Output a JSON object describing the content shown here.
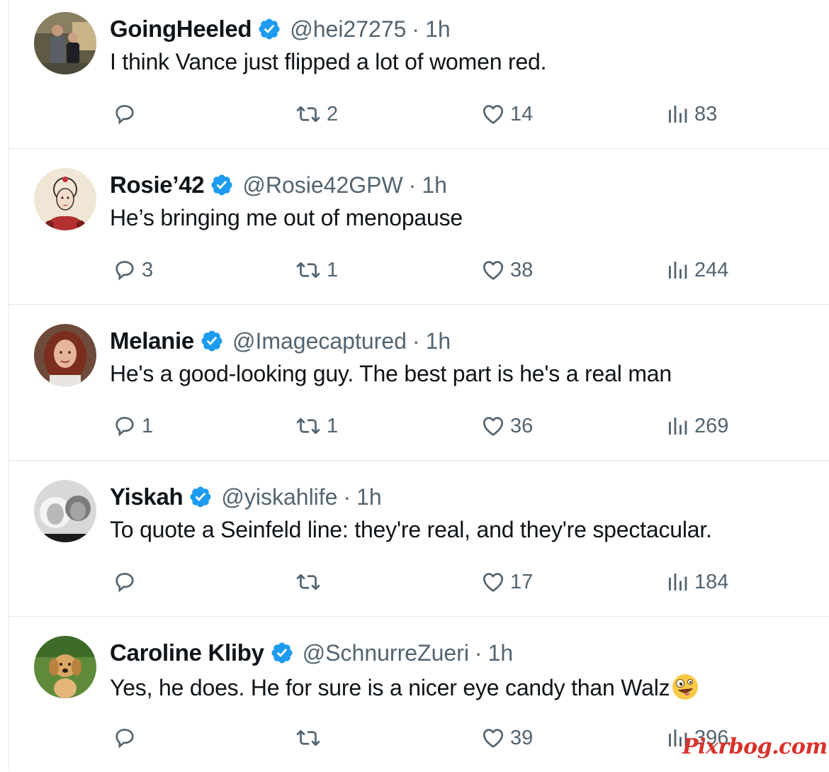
{
  "colors": {
    "text_primary": "#0f1419",
    "text_secondary": "#536471",
    "verified_blue": "#1d9bf0",
    "divider": "#e3e6e9",
    "watermark_red": "#d9312b"
  },
  "icons": {
    "reply": "speech-bubble-icon",
    "retweet": "retweet-arrows-icon",
    "like": "heart-icon",
    "views": "bar-chart-icon",
    "verified": "verified-badge-icon"
  },
  "tweets": [
    {
      "name": "GoingHeeled",
      "handle": "@hei27275",
      "separator": "·",
      "time": "1h",
      "text": "I think Vance just flipped a lot of women red.",
      "replies": "",
      "retweets": "2",
      "likes": "14",
      "views": "83",
      "avatar": "couple-photo-avatar"
    },
    {
      "name": "Rosie’42",
      "handle": "@Rosie42GPW",
      "separator": "·",
      "time": "1h",
      "text": "He’s bringing me out of menopause",
      "replies": "3",
      "retweets": "1",
      "likes": "38",
      "views": "244",
      "avatar": "illustrated-woman-avatar"
    },
    {
      "name": "Melanie",
      "handle": "@Imagecaptured",
      "separator": "·",
      "time": "1h",
      "text": "He's a good-looking guy. The best part is he's a real man",
      "replies": "1",
      "retweets": "1",
      "likes": "36",
      "views": "269",
      "avatar": "redhead-portrait-avatar"
    },
    {
      "name": "Yiskah",
      "handle": "@yiskahlife",
      "separator": "·",
      "time": "1h",
      "text": "To quote a Seinfeld line: they're real, and they're spectacular.",
      "replies": "",
      "retweets": "",
      "likes": "17",
      "views": "184",
      "avatar": "black-white-couple-avatar"
    },
    {
      "name": "Caroline Kliby",
      "handle": "@SchnurreZueri",
      "separator": "·",
      "time": "1h",
      "text": "Yes, he does. He for sure is a nicer eye candy than Walz",
      "emoji": "zany-face-emoji",
      "replies": "",
      "retweets": "",
      "likes": "39",
      "views": "396",
      "avatar": "golden-retriever-puppy-avatar"
    }
  ],
  "watermark": "Pixrbog.com"
}
